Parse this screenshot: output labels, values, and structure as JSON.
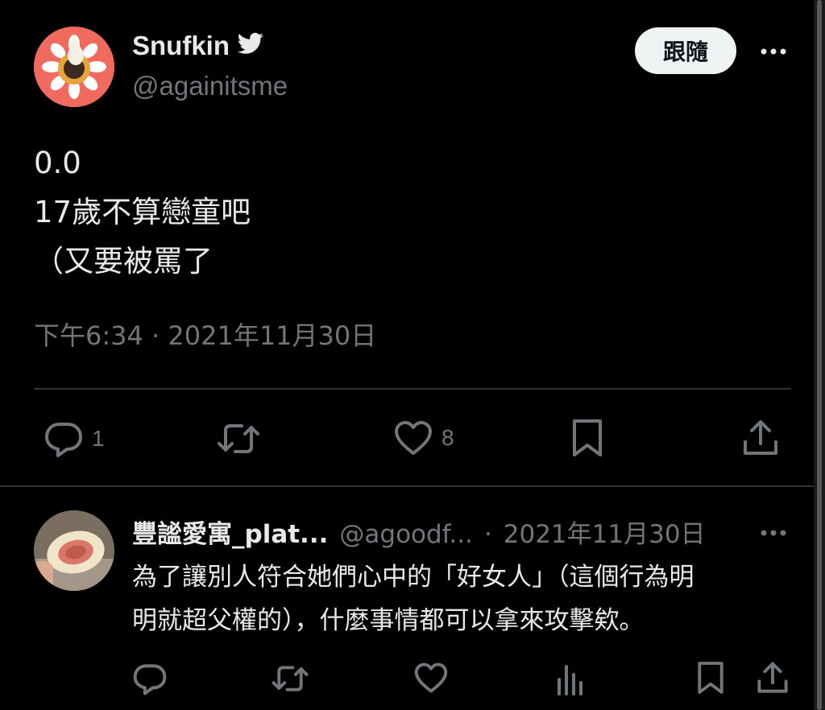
{
  "main_tweet": {
    "author_name": "Snufkin",
    "handle": "@againitsme",
    "follow_label": "跟隨",
    "body_lines": [
      "0.0",
      "17歲不算戀童吧",
      "（又要被罵了"
    ],
    "timestamp": "下午6:34 · 2021年11月30日",
    "actions": {
      "reply_count": "1",
      "like_count": "8"
    }
  },
  "reply_tweet": {
    "author_name": "豐謐愛寓_plat...",
    "handle": "@agoodf...",
    "separator": "·",
    "date": "2021年11月30日",
    "text_lines": [
      "為了讓別人符合她們心中的「好女人」（這個行為明",
      "明就超父權的），什麼事情都可以拿來攻擊欸。"
    ]
  },
  "icons": {
    "verified": "bird-icon",
    "more": "more-icon",
    "reply": "reply-icon",
    "retweet": "retweet-icon",
    "like": "heart-icon",
    "bookmark": "bookmark-icon",
    "share": "share-icon",
    "views": "views-icon"
  },
  "colors": {
    "background": "#000000",
    "text": "#e7e9ea",
    "muted": "#71767b",
    "follow_button": "#eff3f4"
  }
}
